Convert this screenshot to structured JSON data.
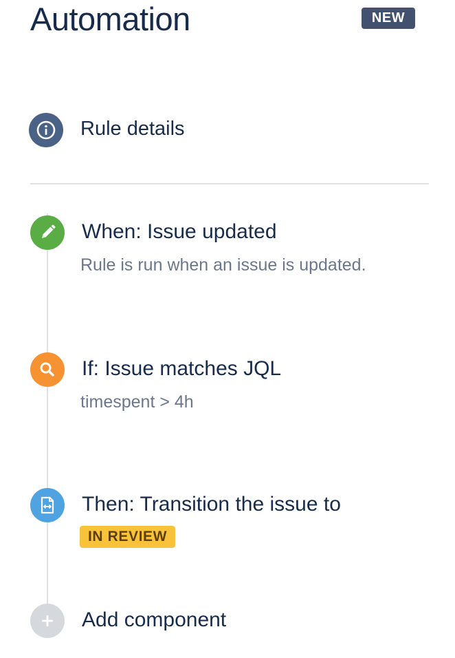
{
  "header": {
    "title": "Automation",
    "badge": "NEW"
  },
  "rule_details": {
    "label": "Rule details",
    "icon": "info-icon",
    "color": "#4a6285"
  },
  "steps": [
    {
      "heading": "When: Issue updated",
      "description": "Rule is run when an issue is updated.",
      "icon": "pencil-icon",
      "color": "#5aac44"
    },
    {
      "heading": "If: Issue matches JQL",
      "description": "timespent > 4h",
      "icon": "search-icon",
      "color": "#f79232"
    },
    {
      "heading": "Then: Transition the issue to",
      "status": "IN REVIEW",
      "icon": "transition-icon",
      "color": "#4fa3e0"
    }
  ],
  "add_component": {
    "label": "Add component",
    "icon": "plus-icon",
    "color": "#d5d8dd"
  },
  "colors": {
    "title_text": "#172b4d",
    "secondary_text": "#6b778c",
    "status_lozenge_bg": "#f8c33b",
    "status_lozenge_text": "#5d3f0c"
  }
}
